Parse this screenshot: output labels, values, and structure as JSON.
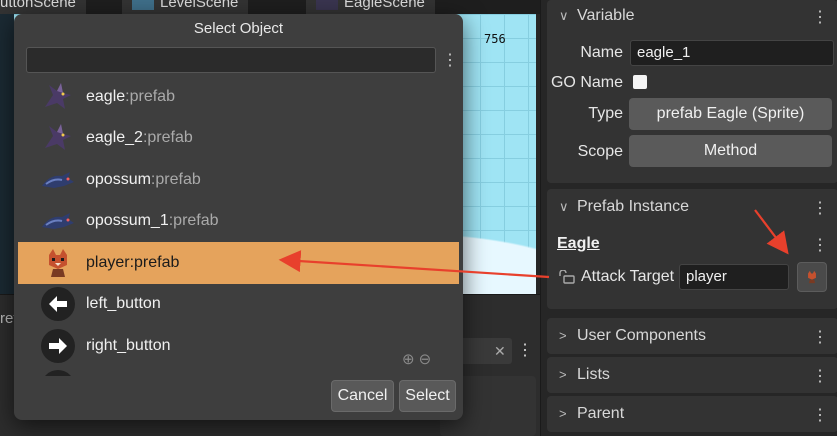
{
  "editor": {
    "tabs": [
      "ButtonScene",
      "LevelScene",
      "EagleScene"
    ],
    "ruler_value": "756",
    "bottom_left_text": "ret"
  },
  "dialog": {
    "title": "Select Object",
    "search_value": "",
    "items": [
      {
        "name": "eagle",
        "suffix": ":prefab",
        "icon": "eagle-sprite-icon",
        "selected": false
      },
      {
        "name": "eagle_2",
        "suffix": ":prefab",
        "icon": "eagle-sprite-icon",
        "selected": false
      },
      {
        "name": "opossum",
        "suffix": ":prefab",
        "icon": "opossum-sprite-icon",
        "selected": false
      },
      {
        "name": "opossum_1",
        "suffix": ":prefab",
        "icon": "opossum-sprite-icon",
        "selected": false
      },
      {
        "name": "player:prefab",
        "suffix": "",
        "icon": "player-sprite-icon",
        "selected": true
      },
      {
        "name": "left_button",
        "suffix": "",
        "icon": "left-arrow-icon",
        "selected": false
      },
      {
        "name": "right_button",
        "suffix": "",
        "icon": "right-arrow-icon",
        "selected": false
      }
    ],
    "cancel_label": "Cancel",
    "select_label": "Select"
  },
  "inspector": {
    "variable": {
      "header": "Variable",
      "name_label": "Name",
      "name_value": "eagle_1",
      "go_name_label": "GO Name",
      "go_name_checked": false,
      "type_label": "Type",
      "type_value": "prefab Eagle (Sprite)",
      "scope_label": "Scope",
      "scope_value": "Method"
    },
    "prefab_instance": {
      "header": "Prefab Instance",
      "prefab_link": "Eagle",
      "attack_target_label": "Attack Target",
      "attack_target_value": "player"
    },
    "user_components_header": "User Components",
    "lists_header": "Lists",
    "parent_header": "Parent"
  },
  "colors": {
    "selection": "#e5a35c",
    "annotation_arrow": "#e8402c"
  }
}
